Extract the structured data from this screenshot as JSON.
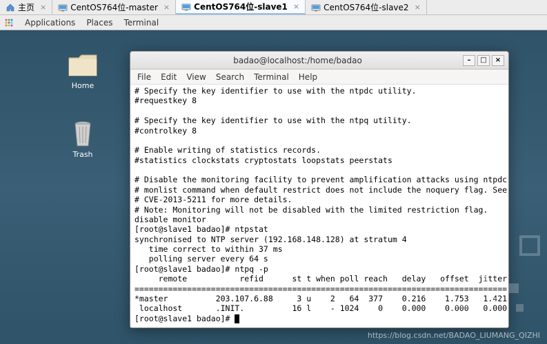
{
  "tabs": [
    {
      "label": "主页",
      "icon": "home"
    },
    {
      "label": "CentOS764位-master",
      "icon": "vm"
    },
    {
      "label": "CentOS764位-slave1",
      "icon": "vm",
      "active": true
    },
    {
      "label": "CentOS764位-slave2",
      "icon": "vm"
    }
  ],
  "gnome_menu": [
    "Applications",
    "Places",
    "Terminal"
  ],
  "desktop_icons": {
    "home": "Home",
    "trash": "Trash"
  },
  "window": {
    "title": "badao@localhost:/home/badao",
    "menu": [
      "File",
      "Edit",
      "View",
      "Search",
      "Terminal",
      "Help"
    ]
  },
  "terminal_lines": [
    "# Specify the key identifier to use with the ntpdc utility.",
    "#requestkey 8",
    "",
    "# Specify the key identifier to use with the ntpq utility.",
    "#controlkey 8",
    "",
    "# Enable writing of statistics records.",
    "#statistics clockstats cryptostats loopstats peerstats",
    "",
    "# Disable the monitoring facility to prevent amplification attacks using ntpdc",
    "# monlist command when default restrict does not include the noquery flag. See",
    "# CVE-2013-5211 for more details.",
    "# Note: Monitoring will not be disabled with the limited restriction flag.",
    "disable monitor",
    "[root@slave1 badao]# ntpstat",
    "synchronised to NTP server (192.168.148.128) at stratum 4",
    "   time correct to within 37 ms",
    "   polling server every 64 s",
    "[root@slave1 badao]# ntpq -p",
    "     remote           refid      st t when poll reach   delay   offset  jitter",
    "==============================================================================",
    "*master          203.107.6.88     3 u    2   64  377    0.216    1.753   1.421",
    " localhost       .INIT.          16 l    - 1024    0    0.000    0.000   0.000",
    "[root@slave1 badao]# "
  ],
  "watermark": "https://blog.csdn.net/BADAO_LIUMANG_QIZHI"
}
